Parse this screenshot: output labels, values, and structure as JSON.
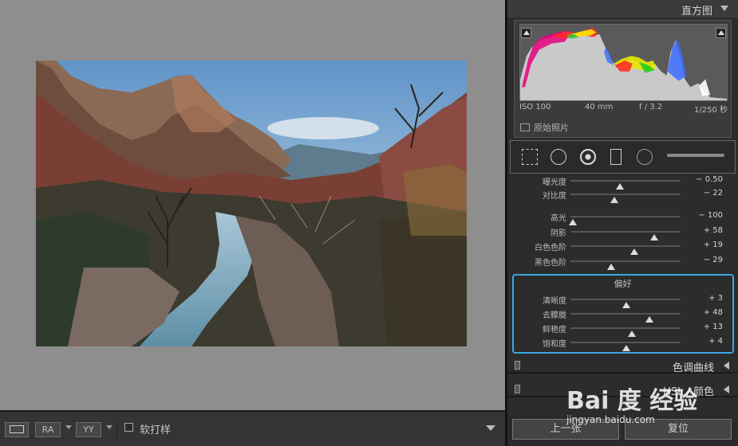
{
  "toolbar": {
    "loupe_icon": "single-view-icon",
    "ra_label": "RA",
    "yy_label": "YY",
    "soft_proof_label": "软打样"
  },
  "histogram": {
    "title": "直方图",
    "exif": {
      "iso": "ISO 100",
      "focal": "40 mm",
      "aperture": "f / 3.2",
      "shutter": "1/250 秒"
    },
    "original_photo_label": "原始照片"
  },
  "tools": [
    "crop-icon",
    "spot-removal-icon",
    "red-eye-icon",
    "graduated-filter-icon",
    "radial-filter-icon",
    "adjustment-brush-icon"
  ],
  "basic": {
    "sliders": [
      {
        "label": "曝光度",
        "value": "− 0.50",
        "pos": 0.45
      },
      {
        "label": "对比度",
        "value": "− 22",
        "pos": 0.4
      },
      {
        "label": "高光",
        "value": "− 100",
        "pos": 0.02
      },
      {
        "label": "阴影",
        "value": "+ 58",
        "pos": 0.76
      },
      {
        "label": "白色色阶",
        "value": "+ 19",
        "pos": 0.58
      },
      {
        "label": "黑色色阶",
        "value": "− 29",
        "pos": 0.37
      }
    ],
    "presence_title": "偏好",
    "presence": [
      {
        "label": "清晰度",
        "value": "+ 3",
        "pos": 0.51
      },
      {
        "label": "去朦胧",
        "value": "+ 48",
        "pos": 0.72
      },
      {
        "label": "鲜艳度",
        "value": "+ 13",
        "pos": 0.56
      },
      {
        "label": "饱和度",
        "value": "+ 4",
        "pos": 0.51
      }
    ]
  },
  "sections": {
    "tone_curve": "色调曲线",
    "hsl": "HSL / 颜色"
  },
  "buttons": {
    "previous": "上一张",
    "reset": "复位"
  },
  "watermark": {
    "brand": "Bai 度 经验",
    "url": "jingyan.baidu.com"
  }
}
